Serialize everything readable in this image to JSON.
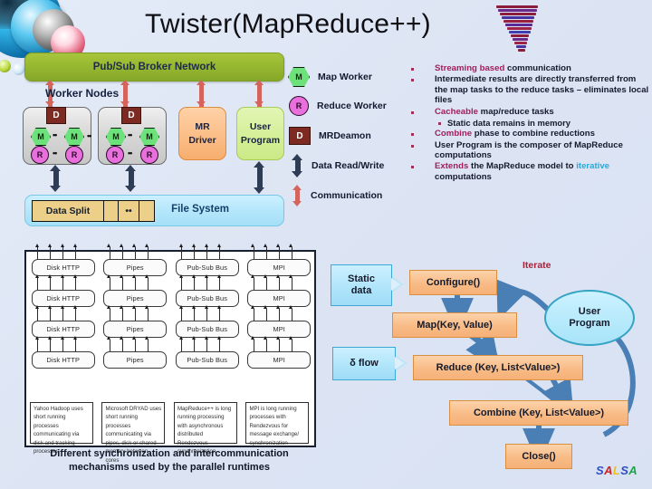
{
  "slide": {
    "title": "Twister(MapReduce++)",
    "logo_icon": "tornado-icon",
    "decor_icon": "globe-cluster-image",
    "brand": {
      "letters": [
        "S",
        "A",
        "L",
        "S",
        "A"
      ],
      "colors": [
        "#2f4fc4",
        "#cf2020",
        "#e8c21a",
        "#2f4fc4",
        "#1fa34a"
      ]
    }
  },
  "architecture": {
    "broker_label": "Pub/Sub Broker Network",
    "worker_nodes_label": "Worker Nodes",
    "node_badges": {
      "daemon": "D",
      "map": "M",
      "reduce": "R",
      "ellipsis": "••"
    },
    "mr_driver": {
      "line1": "MR",
      "line2": "Driver"
    },
    "user_program": {
      "line1": "User",
      "line2": "Program"
    },
    "file_system_label": "File System",
    "data_split_label": "Data Split",
    "split_cells": [
      "Data Split",
      "",
      "••",
      ""
    ]
  },
  "legend": [
    {
      "icon": "map-worker-hex-icon",
      "badge": "M",
      "label": "Map Worker"
    },
    {
      "icon": "reduce-worker-circle-icon",
      "badge": "R",
      "label": "Reduce Worker"
    },
    {
      "icon": "mrdeamon-box-icon",
      "badge": "D",
      "label": "MRDeamon"
    },
    {
      "icon": "data-read-write-arrow-icon",
      "badge": "",
      "label": "Data Read/Write"
    },
    {
      "icon": "communication-arrow-icon",
      "badge": "",
      "label": "Communication"
    }
  ],
  "bullets": [
    {
      "level": 1,
      "parts": [
        {
          "t": "Streaming based ",
          "c": "hi"
        },
        {
          "t": "communication",
          "c": ""
        }
      ]
    },
    {
      "level": 1,
      "parts": [
        {
          "t": "Intermediate results are directly transferred from the map tasks to the reduce tasks – eliminates local files",
          "c": ""
        }
      ]
    },
    {
      "level": 1,
      "parts": [
        {
          "t": "Cacheable ",
          "c": "hi"
        },
        {
          "t": "map/reduce tasks",
          "c": ""
        }
      ]
    },
    {
      "level": 2,
      "parts": [
        {
          "t": "Static data remains in memory",
          "c": ""
        }
      ]
    },
    {
      "level": 1,
      "parts": [
        {
          "t": "Combine ",
          "c": "hi"
        },
        {
          "t": "phase to combine reductions",
          "c": ""
        }
      ]
    },
    {
      "level": 1,
      "parts": [
        {
          "t": "User Program is the composer of MapReduce computations",
          "c": ""
        }
      ]
    },
    {
      "level": 1,
      "parts": [
        {
          "t": "Extends ",
          "c": "hi"
        },
        {
          "t": "the MapReduce model to ",
          "c": ""
        },
        {
          "t": "iterative",
          "c": "hi2"
        },
        {
          "t": " computations",
          "c": ""
        }
      ]
    }
  ],
  "runtime_figure": {
    "columns": [
      {
        "bus": "Disk HTTP",
        "description": "Yahoo Hadoop uses short running processes communicating via disk and tracking processes"
      },
      {
        "bus": "Pipes",
        "description": "Microsoft DRYAD uses short running processes communicating via pipes, disk or shared memory between cores"
      },
      {
        "bus": "Pub-Sub Bus",
        "description": "MapReduce++ is long running processing with asynchronous distributed Rendezvous synchronization"
      },
      {
        "bus": "MPI",
        "description": "MPI is long running processes with Rendezvous for message exchange/ synchronization"
      }
    ],
    "rows": 4,
    "caption_line1": "Different synchronization and intercommunication",
    "caption_line2": "mechanisms used by the parallel runtimes"
  },
  "flow": {
    "static_data": "Static\ndata",
    "static_data_line1": "Static",
    "static_data_line2": "data",
    "delta_flow": "δ flow",
    "configure": "Configure()",
    "map": "Map(Key, Value)",
    "reduce": "Reduce (Key, List<Value>)",
    "combine": "Combine (Key, List<Value>)",
    "close": "Close()",
    "iterate": "Iterate",
    "user_program_line1": "User",
    "user_program_line2": "Program"
  },
  "colors": {
    "broker_green": "#93b52f",
    "arrow_red": "#d4645c",
    "arrow_navy": "#2e3c56",
    "orange_box": "#f8bb86",
    "cyan_box": "#aee4fa",
    "highlight_magenta": "#a21d5b",
    "highlight_cyan": "#2aa8d8"
  }
}
